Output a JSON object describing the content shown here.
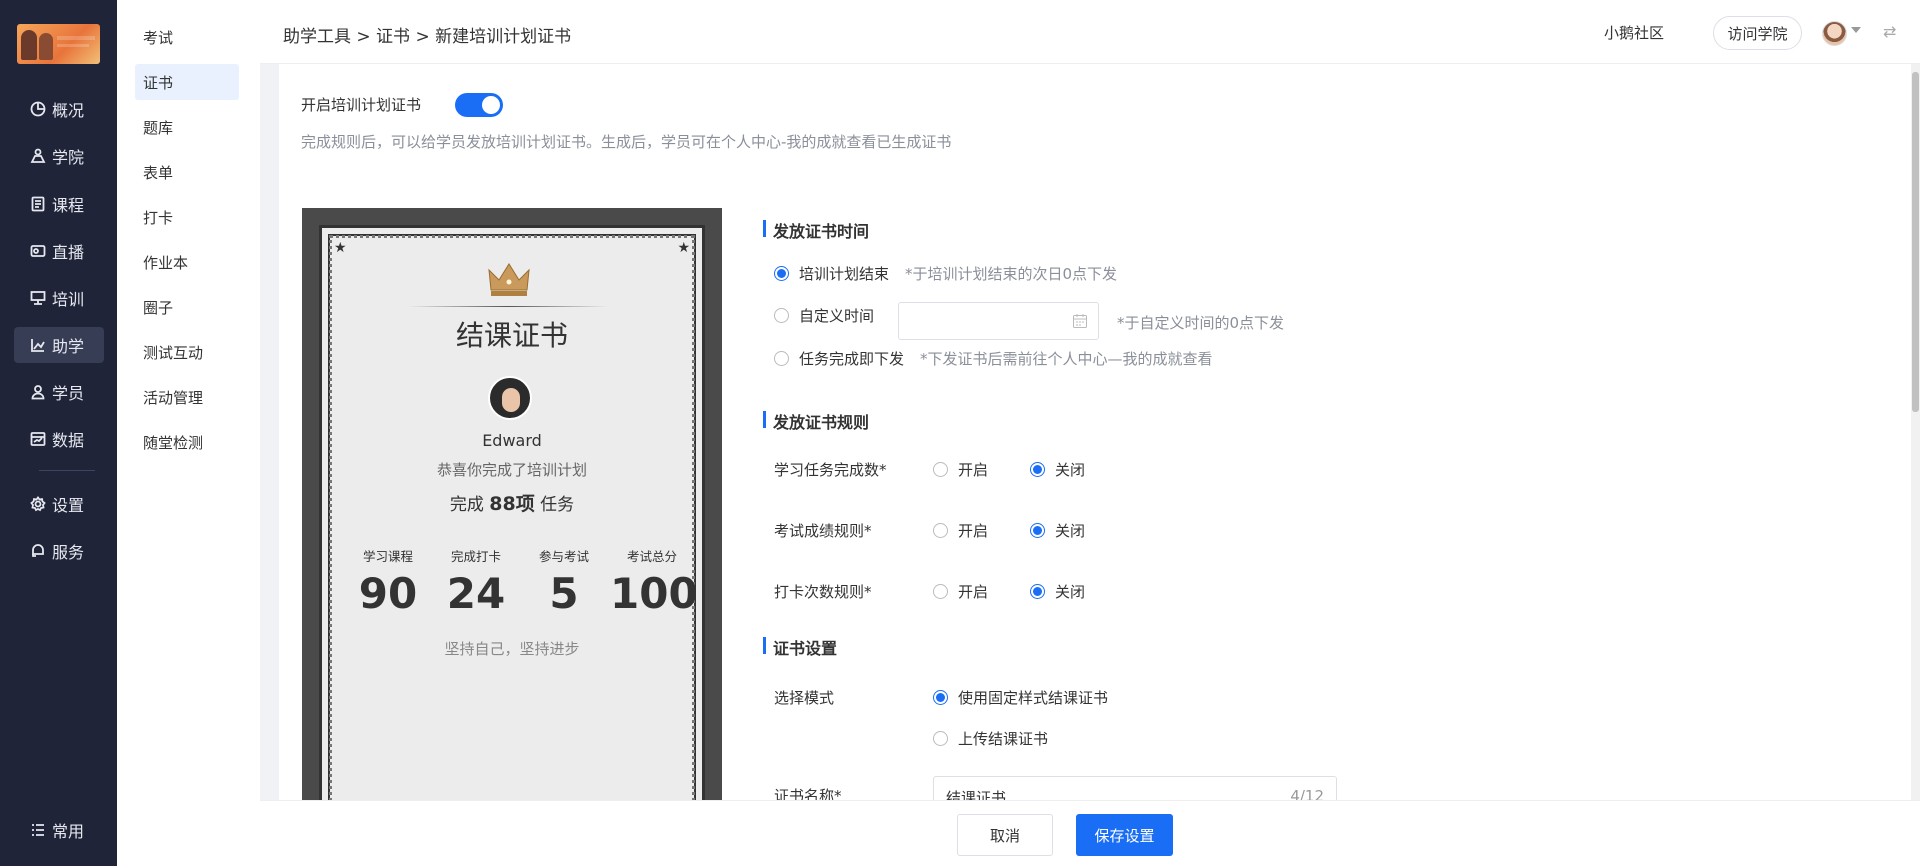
{
  "nav": {
    "items": [
      {
        "label": "概况",
        "icon": "pie-chart-icon"
      },
      {
        "label": "学院",
        "icon": "academy-icon"
      },
      {
        "label": "课程",
        "icon": "course-book-icon"
      },
      {
        "label": "直播",
        "icon": "live-camera-icon"
      },
      {
        "label": "培训",
        "icon": "training-board-icon"
      },
      {
        "label": "助学",
        "icon": "study-chart-icon"
      },
      {
        "label": "学员",
        "icon": "student-user-icon"
      },
      {
        "label": "数据",
        "icon": "data-icon"
      },
      {
        "label": "设置",
        "icon": "gear-icon"
      },
      {
        "label": "服务",
        "icon": "service-icon"
      },
      {
        "label": "常用",
        "icon": "list-icon"
      }
    ],
    "active": "助学"
  },
  "submenu": {
    "items": [
      "考试",
      "证书",
      "题库",
      "表单",
      "打卡",
      "作业本",
      "圈子",
      "测试互动",
      "活动管理",
      "随堂检测"
    ],
    "active": "证书"
  },
  "header": {
    "breadcrumb": "助学工具 > 证书 > 新建培训计划证书",
    "community": "小鹅社区",
    "visit": "访问学院"
  },
  "toggle": {
    "label": "开启培训计划证书",
    "on": true,
    "desc": "完成规则后，可以给学员发放培训计划证书。生成后，学员可在个人中心-我的成就查看已生成证书"
  },
  "certificate": {
    "title": "结课证书",
    "name": "Edward",
    "subtitle": "恭喜你完成了培训计划",
    "done_prefix": "完成",
    "done_count": "88项",
    "done_suffix": "任务",
    "stats": [
      {
        "label": "学习课程",
        "value": "90"
      },
      {
        "label": "完成打卡",
        "value": "24"
      },
      {
        "label": "参与考试",
        "value": "5"
      },
      {
        "label": "考试总分",
        "value": "100"
      }
    ],
    "motto": "坚持自己，坚持进步"
  },
  "issue_time": {
    "title": "发放证书时间",
    "options": [
      {
        "label": "培训计划结束",
        "hint": "*于培训计划结束的次日0点下发",
        "selected": true
      },
      {
        "label": "自定义时间",
        "hint": "*于自定义时间的0点下发",
        "selected": false
      },
      {
        "label": "任务完成即下发",
        "hint": "*下发证书后需前往个人中心—我的成就查看",
        "selected": false
      }
    ]
  },
  "issue_rules": {
    "title": "发放证书规则",
    "on_label": "开启",
    "off_label": "关闭",
    "rules": [
      {
        "label": "学习任务完成数*",
        "value": "off"
      },
      {
        "label": "考试成绩规则*",
        "value": "off"
      },
      {
        "label": "打卡次数规则*",
        "value": "off"
      }
    ]
  },
  "cert_settings": {
    "title": "证书设置",
    "mode_label": "选择模式",
    "modes": [
      {
        "label": "使用固定样式结课证书",
        "selected": true
      },
      {
        "label": "上传结课证书",
        "selected": false
      }
    ],
    "name_label": "证书名称*",
    "name_value": "结课证书",
    "name_count": "4/12"
  },
  "footer": {
    "cancel": "取消",
    "save": "保存设置"
  },
  "colors": {
    "primary": "#1a6ef5",
    "nav_bg": "#1f2438"
  }
}
